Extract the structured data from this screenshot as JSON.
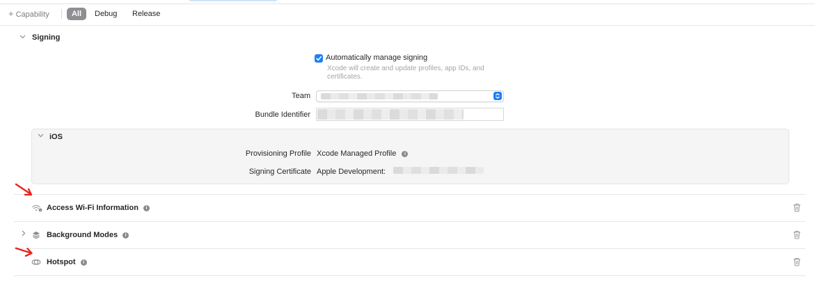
{
  "toolbar": {
    "add_capability": "Capability",
    "plus": "+",
    "filters": [
      "All",
      "Debug",
      "Release"
    ]
  },
  "signing": {
    "title": "Signing",
    "auto_manage_label": "Automatically manage signing",
    "auto_manage_checked": true,
    "auto_manage_description": "Xcode will create and update profiles, app IDs, and certificates.",
    "team_label": "Team",
    "bundle_label": "Bundle Identifier",
    "ios": {
      "title": "iOS",
      "provisioning_label": "Provisioning Profile",
      "provisioning_value": "Xcode Managed Profile",
      "certificate_label": "Signing Certificate",
      "certificate_value": "Apple Development:"
    }
  },
  "capabilities": [
    {
      "title": "Access Wi-Fi Information",
      "icon": "wifi-info-icon",
      "expandable": false
    },
    {
      "title": "Background Modes",
      "icon": "layers-icon",
      "expandable": true
    },
    {
      "title": "Hotspot",
      "icon": "hotspot-icon",
      "expandable": false
    }
  ],
  "colors": {
    "accent": "#1f7ff5",
    "annotation_arrow": "#e8241c",
    "segment_selected": "#8e8e93"
  }
}
